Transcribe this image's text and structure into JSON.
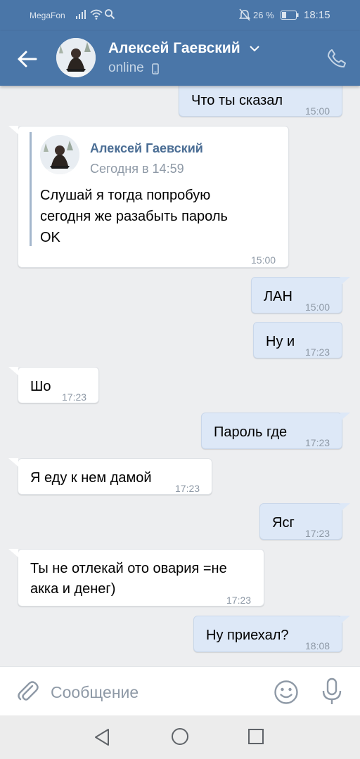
{
  "status_bar": {
    "carrier": "MegaFon",
    "battery": "26 %",
    "time": "18:15"
  },
  "header": {
    "name": "Алексей Гаевский",
    "status": "online"
  },
  "messages": [
    {
      "text": "Что ты сказал",
      "time": "15:00",
      "direction": "out"
    },
    {
      "text": "ЛАН",
      "time": "15:00",
      "direction": "out"
    },
    {
      "text": "Ну и",
      "time": "17:23",
      "direction": "out"
    },
    {
      "text": "Шо",
      "time": "17:23",
      "direction": "in"
    },
    {
      "text": "Пароль где",
      "time": "17:23",
      "direction": "out"
    },
    {
      "text": "Я еду к нем дамой",
      "time": "17:23",
      "direction": "in"
    },
    {
      "text": "Ясг",
      "time": "17:23",
      "direction": "out"
    },
    {
      "text_line1": "Ты не отлекай ото овария =не",
      "text_line2": "акка и денег)",
      "time": "17:23",
      "direction": "in"
    },
    {
      "text": "Ну приехал?",
      "time": "18:08",
      "direction": "out"
    }
  ],
  "forwarded": {
    "author": "Алексей Гаевский",
    "date": "Сегодня в 14:59",
    "line1": "Слушай я тогда попробую",
    "line2": "сегодня же разабыть пароль",
    "line3": "OK",
    "time": "15:00"
  },
  "composer": {
    "placeholder": "Сообщение"
  },
  "colors": {
    "header": "#4a76a8",
    "background": "#edeef0",
    "outgoing_bubble": "#dde8f7",
    "incoming_bubble": "#ffffff",
    "forward_author": "#4a6d94"
  },
  "icons": {
    "back": "arrow-left-icon",
    "call": "phone-icon",
    "attach": "paperclip-icon",
    "emoji": "smiley-icon",
    "mic": "microphone-icon"
  }
}
